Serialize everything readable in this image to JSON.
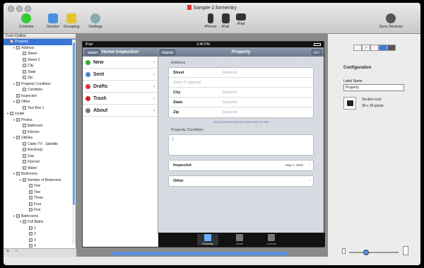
{
  "window": {
    "title": "Sample-2.formentry"
  },
  "toolbar": {
    "controls": "Controls",
    "section": "Section",
    "grouping": "Grouping",
    "settings": "Settings",
    "iphone": "iPhone",
    "ipad_1": "iPad",
    "ipad_2": "iPad",
    "sync": "Sync Devices"
  },
  "sidebar": {
    "header": "Form Outline",
    "rows": [
      {
        "label": "Property",
        "indent": 0,
        "tri": "▼",
        "sel": true
      },
      {
        "label": "Address",
        "indent": 1,
        "tri": "▼"
      },
      {
        "label": "Street",
        "indent": 2
      },
      {
        "label": "Street 2",
        "indent": 2
      },
      {
        "label": "City",
        "indent": 2
      },
      {
        "label": "State",
        "indent": 2
      },
      {
        "label": "Zip",
        "indent": 2
      },
      {
        "label": "Property Condition",
        "indent": 1,
        "tri": "▼"
      },
      {
        "label": "Condition",
        "indent": 2
      },
      {
        "label": "Inspected",
        "indent": 1
      },
      {
        "label": "Other",
        "indent": 1,
        "tri": "▼"
      },
      {
        "label": "Text Box 1",
        "indent": 2
      },
      {
        "label": "Inside",
        "indent": 0,
        "tri": "▼"
      },
      {
        "label": "Photos",
        "indent": 1,
        "tri": "▼"
      },
      {
        "label": "Bathroom",
        "indent": 2
      },
      {
        "label": "Kitchen",
        "indent": 2
      },
      {
        "label": "Utilities",
        "indent": 1,
        "tri": "▼"
      },
      {
        "label": "Cable TV - Satellite",
        "indent": 2
      },
      {
        "label": "Electricity",
        "indent": 2
      },
      {
        "label": "Gas",
        "indent": 2
      },
      {
        "label": "Internet",
        "indent": 2
      },
      {
        "label": "Water",
        "indent": 2
      },
      {
        "label": "Bedrooms",
        "indent": 1,
        "tri": "▼"
      },
      {
        "label": "Number of Bedrooms",
        "indent": 2,
        "tri": "▼"
      },
      {
        "label": "One",
        "indent": 3
      },
      {
        "label": "Two",
        "indent": 3
      },
      {
        "label": "Three",
        "indent": 3
      },
      {
        "label": "Four",
        "indent": 3
      },
      {
        "label": "Five",
        "indent": 3
      },
      {
        "label": "Bathrooms",
        "indent": 1,
        "tri": "▼"
      },
      {
        "label": "Full Baths",
        "indent": 2,
        "tri": "▼"
      },
      {
        "label": "1",
        "indent": 3
      },
      {
        "label": "2",
        "indent": 3
      },
      {
        "label": "3",
        "indent": 3
      },
      {
        "label": "4",
        "indent": 3
      }
    ],
    "add": "+",
    "remove": "−"
  },
  "ipad": {
    "carrier": "iPad",
    "time": "2:46 PM",
    "left_nav": {
      "back": "Home",
      "title": "Home Inspection"
    },
    "menu": [
      {
        "label": "New",
        "color": "#3a3"
      },
      {
        "label": "Sent",
        "color": "#48c"
      },
      {
        "label": "Drafts",
        "color": "#d33"
      },
      {
        "label": "Trash",
        "color": "#c22"
      },
      {
        "label": "About",
        "color": "#777"
      }
    ],
    "right_nav": {
      "cancel": "Cancel",
      "title": "Property"
    },
    "address": {
      "header": "Address",
      "street": "Street",
      "street_ph": "Required",
      "street2_ph": "Street 2 (optional)",
      "city": "City",
      "city_ph": "Required",
      "state": "State",
      "state_ph": "Required",
      "zip": "Zip",
      "zip_ph": "Required",
      "note": "All properties must be inspected on site"
    },
    "condition": {
      "header": "Property Condition"
    },
    "inspected": {
      "label": "Inspected",
      "value": "May 7, 2010"
    },
    "other": {
      "label": "Other"
    },
    "tabs": {
      "property": "Property",
      "inside": "Inside",
      "outside": "Outside"
    }
  },
  "inspector": {
    "heading": "Configuration",
    "label_name": "Label Name",
    "label_value": "Property",
    "section_icon": "Section Icon",
    "icon_size": "30 x 30 pixels"
  }
}
